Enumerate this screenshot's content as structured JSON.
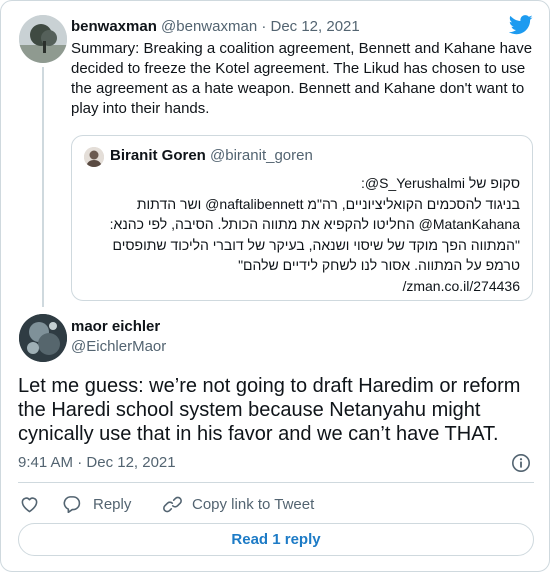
{
  "parent_tweet": {
    "display_name": "benwaxman",
    "handle": "@benwaxman",
    "separator": "·",
    "date": "Dec 12, 2021",
    "text": "Summary: Breaking a coalition agreement, Bennett and Kahane have decided to freeze the Kotel agreement. The Likud has chosen to use the agreement as a hate weapon. Bennett and Kahane don't want to play into their hands.",
    "avatar_icon": "tree-landscape-avatar"
  },
  "quoted_tweet": {
    "display_name": "Biranit Goren",
    "handle": "@biranit_goren",
    "lines": [
      "סקופ של S_Yerushalmi@:",
      "בניגוד להסכמים הקואליציוניים, רה\"מ naftalibennett@ ושר הדתות",
      "MatanKahana@ החליטו להקפיא את מתווה הכותל. הסיבה, לפי כהנא:",
      "\"המתווה הפך מוקד של שיסוי ושנאה, בעיקר של דוברי הליכוד שתופסים",
      "טרמפ על המתווה. אסור לנו לשחק לידיים שלהם\"",
      "zman.co.il/274436/"
    ]
  },
  "main_tweet": {
    "display_name": "maor eichler",
    "handle": "@EichlerMaor",
    "text": "Let me guess: we’re not going to draft Haredim or reform the Haredi school system because Netanyahu might cynically use that in his favor and we can’t have THAT.",
    "time": "9:41 AM",
    "separator": "·",
    "date": "Dec 12, 2021",
    "avatar_icon": "dark-photo-avatar"
  },
  "actions": {
    "reply_label": "Reply",
    "copy_label": "Copy link to Tweet"
  },
  "read_reply_label": "Read 1 reply",
  "colors": {
    "twitter_blue": "#1d9bf0",
    "link_blue": "#1d7bc6",
    "text": "#0f1419",
    "muted": "#536471",
    "border": "#cfd9de"
  }
}
